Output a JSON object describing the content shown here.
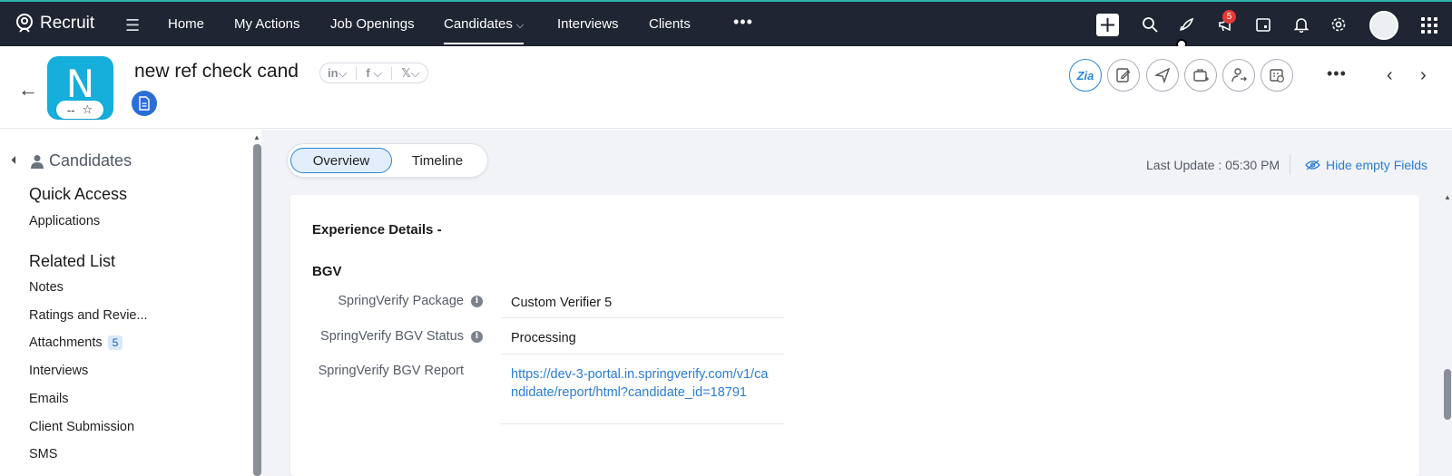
{
  "topnav": {
    "brand": "Recruit",
    "items": [
      {
        "label": "Home"
      },
      {
        "label": "My Actions"
      },
      {
        "label": "Job Openings"
      },
      {
        "label": "Candidates",
        "active": true
      },
      {
        "label": "Interviews"
      },
      {
        "label": "Clients"
      }
    ],
    "notification_count": "5"
  },
  "record": {
    "avatar_letter": "N",
    "rating_value": "--",
    "name": "new ref check cand",
    "social": [
      "in",
      "f",
      "𝕏"
    ]
  },
  "leftpanel": {
    "module": "Candidates",
    "quick_access_title": "Quick Access",
    "quick_access": [
      {
        "label": "Applications"
      }
    ],
    "related_title": "Related List",
    "related": [
      {
        "label": "Notes"
      },
      {
        "label": "Ratings and Revie..."
      },
      {
        "label": "Attachments",
        "count": "5"
      },
      {
        "label": "Interviews"
      },
      {
        "label": "Emails"
      },
      {
        "label": "Client Submission"
      },
      {
        "label": "SMS"
      }
    ]
  },
  "main": {
    "tabs": [
      {
        "label": "Overview"
      },
      {
        "label": "Timeline"
      }
    ],
    "last_update": "Last Update : 05:30 PM",
    "hide_empty": "Hide empty Fields",
    "section_title": "Experience Details -",
    "subsection_title": "BGV",
    "fields": [
      {
        "label": "SpringVerify Package",
        "value": "Custom Verifier 5"
      },
      {
        "label": "SpringVerify BGV Status",
        "value": "Processing"
      },
      {
        "label": "SpringVerify BGV Report",
        "value": "https://dev-3-portal.in.springverify.com/v1/candidate/report/html?candidate_id=18791"
      }
    ]
  },
  "colors": {
    "nav_bg": "#1f2532",
    "avatar_bg": "#16aedb",
    "accent": "#2a7cd6",
    "badge": "#e53935"
  }
}
